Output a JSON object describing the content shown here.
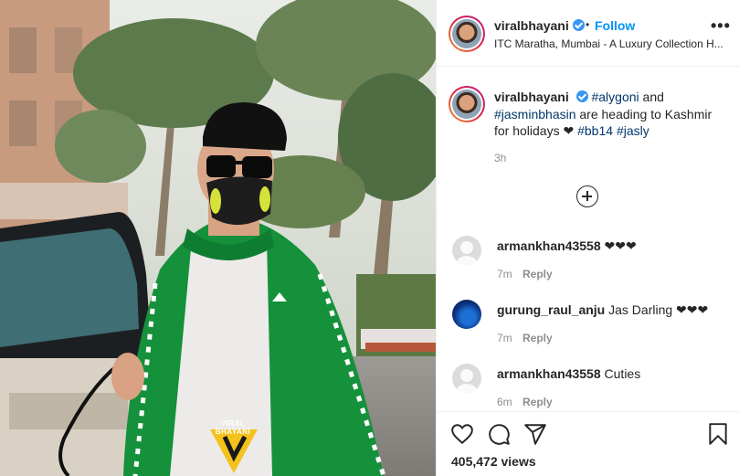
{
  "post": {
    "username": "viralbhayani",
    "follow_label": "Follow",
    "separator": "•",
    "location": "ITC Maratha, Mumbai - A Luxury Collection H...",
    "more_icon": "more-horizontal-icon",
    "watermark": "VIRAL BHAYANI"
  },
  "caption": {
    "username": "viralbhayani",
    "tag1": "#alygoni",
    "text1": " and ",
    "tag2": "#jasminbhasin",
    "text2": " are heading to Kashmir for holidays ❤ ",
    "tag3": "#bb14",
    "tag4": "#jasly",
    "time": "3h"
  },
  "comments": [
    {
      "username": "armankhan43558",
      "text": "❤❤❤",
      "time": "7m",
      "reply": "Reply"
    },
    {
      "username": "gurung_raul_anju",
      "text": "Jas Darling ❤❤❤",
      "time": "7m",
      "reply": "Reply"
    },
    {
      "username": "armankhan43558",
      "text": "Cuties",
      "time": "6m",
      "reply": "Reply"
    }
  ],
  "footer": {
    "views": "405,472 views",
    "icons": [
      "heart-icon",
      "comment-icon",
      "share-icon",
      "bookmark-icon"
    ]
  },
  "colors": {
    "link": "#0095f6",
    "hashtag": "#00376b",
    "verified": "#3897f0",
    "muted": "#8e8e8e",
    "jacket": "#14913a"
  }
}
